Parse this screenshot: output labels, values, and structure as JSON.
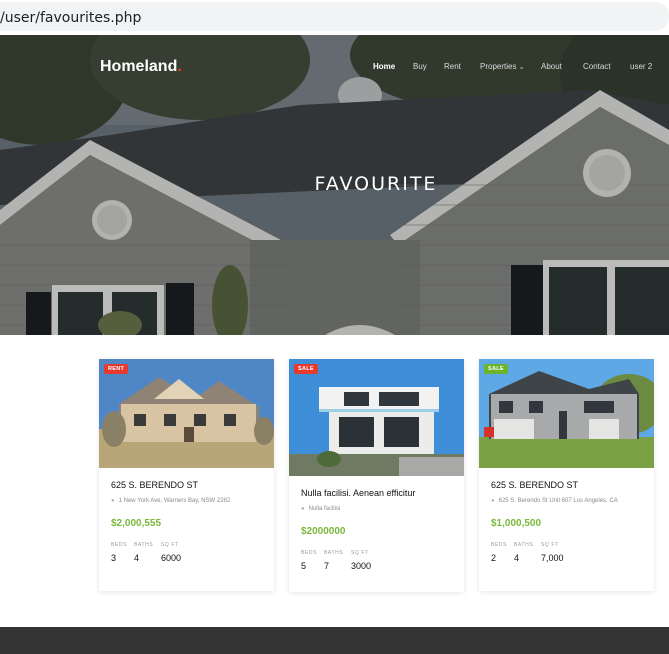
{
  "browser": {
    "url": "/user/favourites.php"
  },
  "site": {
    "brand": "Homeland",
    "brand_dot": ".",
    "nav": [
      "Home",
      "Buy",
      "Rent",
      "Properties",
      "About",
      "Contact",
      "user 2"
    ],
    "properties_caret": "⌄"
  },
  "hero": {
    "title": "FAVOURITE"
  },
  "stat_labels": {
    "beds": "BEDS",
    "baths": "BATHS",
    "sqft": "SQ FT"
  },
  "listings": [
    {
      "badge": "RENT",
      "badge_color": "#e63a2e",
      "title": "625 S. BERENDO ST",
      "address": "1 New York Ave, Warners Bay, NSW 2282",
      "price": "$2,000,555",
      "beds": "3",
      "baths": "4",
      "sqft": "6000"
    },
    {
      "badge": "SALE",
      "badge_color": "#e63a2e",
      "title": "Nulla facilisi. Aenean efficitur",
      "address": "Nulla facilisi",
      "price": "$2000000",
      "beds": "5",
      "baths": "7",
      "sqft": "3000"
    },
    {
      "badge": "SALE",
      "badge_color": "#6bb52e",
      "title": "625 S. BERENDO ST",
      "address": "625 S. Berendo St Unit 607 Los Angeles, CA",
      "price": "$1,000,500",
      "beds": "2",
      "baths": "4",
      "sqft": "7,000"
    }
  ],
  "colors": {
    "accent_green": "#79b83a",
    "accent_red": "#e63a2e",
    "footer": "#333333"
  }
}
